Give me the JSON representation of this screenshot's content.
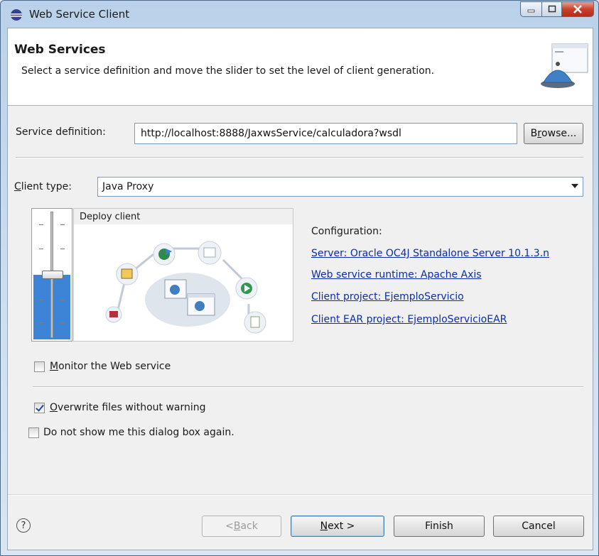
{
  "window": {
    "title": "Web Service Client"
  },
  "banner": {
    "title": "Web Services",
    "description": "Select a service definition and move the slider to set the level of client generation."
  },
  "service": {
    "label": "Service definition:",
    "value": "http://localhost:8888/JaxwsService/calculadora?wsdl",
    "browse_label_pre": "B",
    "browse_label_u": "r",
    "browse_label_post": "owse..."
  },
  "client_type": {
    "label_u": "C",
    "label_rest": "lient type:",
    "value": "Java Proxy"
  },
  "slider": {
    "level_label": "Deploy client",
    "level_fraction": 0.5
  },
  "configuration": {
    "title": "Configuration:",
    "links": [
      "Server: Oracle OC4J Standalone Server 10.1.3.n",
      "Web service runtime: Apache Axis",
      "Client project: EjemploServicio",
      "Client EAR project: EjemploServicioEAR"
    ]
  },
  "options": {
    "monitor_u": "M",
    "monitor_rest": "onitor the Web service",
    "monitor_checked": false,
    "overwrite_u": "O",
    "overwrite_rest": "verwrite files without warning",
    "overwrite_checked": true,
    "dont_show": "Do not show me this dialog box again.",
    "dont_show_checked": false
  },
  "footer": {
    "help_glyph": "?",
    "back_pre": "< ",
    "back_u": "B",
    "back_post": "ack",
    "next_u": "N",
    "next_post": "ext >",
    "finish": "Finish",
    "cancel": "Cancel"
  },
  "colors": {
    "link": "#0a2dac",
    "slider_fill": "#3d84d6"
  }
}
